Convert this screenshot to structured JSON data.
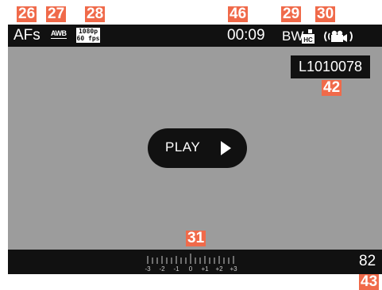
{
  "callouts": {
    "c26": "26",
    "c27": "27",
    "c28": "28",
    "c46": "46",
    "c29": "29",
    "c30": "30",
    "c42": "42",
    "c31": "31",
    "c43": "43"
  },
  "status_bar": {
    "focus_mode": "AFs",
    "white_balance": "AWB",
    "video_resolution": "1080p",
    "frame_rate": "60 fps",
    "elapsed_time": "00:09",
    "film_style": "BW",
    "film_style_badge": "HC",
    "video_mode_icon": "video-camera-icon",
    "audio_icon": "microphone-level-icon"
  },
  "file": {
    "name": "L1010078"
  },
  "playback": {
    "play_label": "PLAY"
  },
  "bottom_bar": {
    "exposure_scale_labels": [
      "-3",
      "-2",
      "-1",
      "0",
      "+1",
      "+2",
      "+3"
    ],
    "remaining": "82"
  },
  "colors": {
    "callout": "#f06a4a",
    "bars": "#111111",
    "screen": "#9c9c9c"
  }
}
